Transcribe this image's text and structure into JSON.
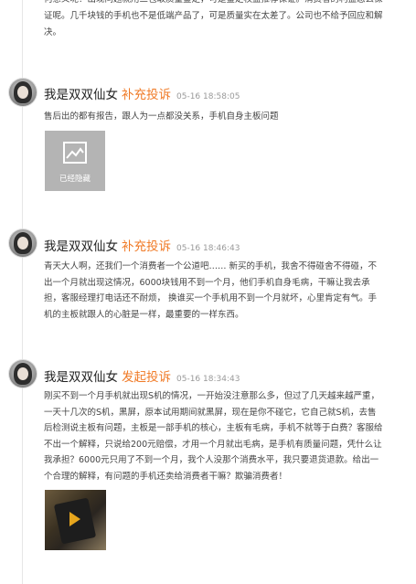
{
  "top_text": "何意义呢？出现问题就用三包取质量鉴定，可是鉴定权益推荐保证。消费者的利益怎么保证呢。几千块钱的手机也不是低端产品了，可是质量实在太差了。公司也不给予回应和解决。",
  "entries": [
    {
      "user": "我是双双仙女",
      "action": "补充投诉",
      "time": "05-16 18:58:05",
      "body": "售后出的都有报告，跟人为一点都没关系，手机自身主板问题",
      "image_caption": "已经隐藏"
    },
    {
      "user": "我是双双仙女",
      "action": "补充投诉",
      "time": "05-16 18:46:43",
      "body": "青天大人啊，还我们一个消费者一个公道吧…… 新买的手机，我舍不得碰舍不得碰，不出一个月就出现这情况，6000块钱用不到一个月，他们手机自身毛病，干嘛让我去承担，客服经理打电话还不耐烦， 换谁买一个手机用不到一个月就坏，心里肯定有气。手机的主板就跟人的心脏是一样，最重要的一样东西。"
    },
    {
      "user": "我是双双仙女",
      "action": "发起投诉",
      "time": "05-16 18:34:43",
      "body": "刚买不到一个月手机就出现S机的情况，一开始没注意那么多，但过了几天越来越严重，一天十几次的S机，黑屏，原本试用期间就黑屏，现在是你不碰它，它自己就S机，去售后检测说主板有问题，主板是一部手机的核心，主板有毛病，手机不就等于白费？客服给不出一个解释，只说给200元赔偿，才用一个月就出毛病，是手机有质量问题，凭什么让我承担？6000元只用了不到一个月，我个人没那个消费水平，我只要退货退款。给出一个合理的解释，有问题的手机还卖给消费者干嘛？欺骗消费者！"
    }
  ]
}
